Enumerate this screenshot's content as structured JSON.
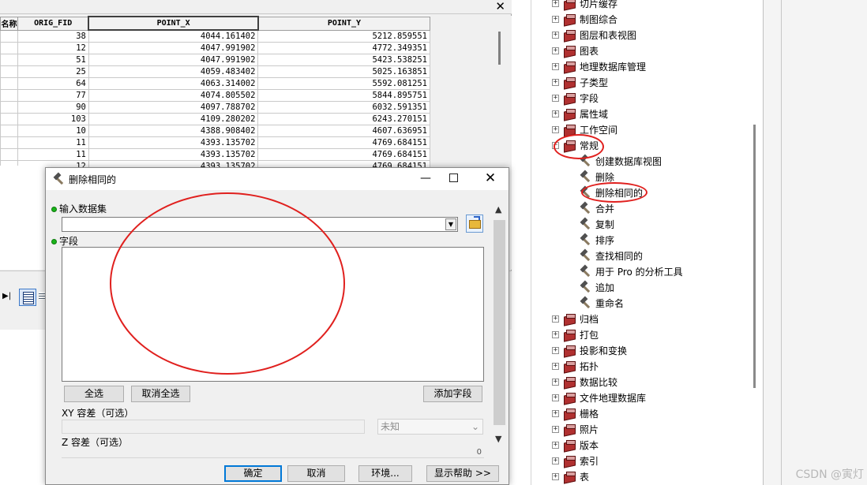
{
  "attribute_table": {
    "columns": [
      "名称",
      "ORIG_FID",
      "POINT_X",
      "POINT_Y"
    ],
    "rows": [
      {
        "orig_fid": "38",
        "point_x": "4044.161402",
        "point_y": "5212.859551"
      },
      {
        "orig_fid": "12",
        "point_x": "4047.991902",
        "point_y": "4772.349351"
      },
      {
        "orig_fid": "51",
        "point_x": "4047.991902",
        "point_y": "5423.538251"
      },
      {
        "orig_fid": "25",
        "point_x": "4059.483402",
        "point_y": "5025.163851"
      },
      {
        "orig_fid": "64",
        "point_x": "4063.314002",
        "point_y": "5592.081251"
      },
      {
        "orig_fid": "77",
        "point_x": "4074.805502",
        "point_y": "5844.895751"
      },
      {
        "orig_fid": "90",
        "point_x": "4097.788702",
        "point_y": "6032.591351"
      },
      {
        "orig_fid": "103",
        "point_x": "4109.280202",
        "point_y": "6243.270151"
      },
      {
        "orig_fid": "10",
        "point_x": "4388.908402",
        "point_y": "4607.636951"
      },
      {
        "orig_fid": "11",
        "point_x": "4393.135702",
        "point_y": "4769.684151"
      },
      {
        "orig_fid": "11",
        "point_x": "4393.135702",
        "point_y": "4769.684151"
      },
      {
        "orig_fid": "12",
        "point_x": "4393.135702",
        "point_y": "4769.684151"
      }
    ],
    "close_label": "✕"
  },
  "dialog": {
    "title": "删除相同的",
    "input_dataset_label": "输入数据集",
    "input_dataset_value": "",
    "fields_label": "字段",
    "select_all_label": "全选",
    "deselect_all_label": "取消全选",
    "add_field_label": "添加字段",
    "xy_tolerance_label": "XY 容差（可选）",
    "xy_tolerance_unit": "未知",
    "z_tolerance_label": "Z 容差（可选）",
    "z_tolerance_value": "0",
    "ok_label": "确定",
    "cancel_label": "取消",
    "environments_label": "环境...",
    "show_help_label": "显示帮助 >>",
    "minimize_glyph": "—",
    "close_glyph": "✕"
  },
  "toolbox_tree": {
    "toolsets": [
      {
        "label": "切片缓存",
        "expanded": false
      },
      {
        "label": "制图综合",
        "expanded": false
      },
      {
        "label": "图层和表视图",
        "expanded": false
      },
      {
        "label": "图表",
        "expanded": false
      },
      {
        "label": "地理数据库管理",
        "expanded": false
      },
      {
        "label": "子类型",
        "expanded": false
      },
      {
        "label": "字段",
        "expanded": false
      },
      {
        "label": "属性域",
        "expanded": false
      },
      {
        "label": "工作空间",
        "expanded": false
      },
      {
        "label": "常规",
        "expanded": true
      }
    ],
    "general_tools": [
      "创建数据库视图",
      "删除",
      "删除相同的",
      "合并",
      "复制",
      "排序",
      "查找相同的",
      "用于 Pro 的分析工具",
      "追加",
      "重命名"
    ],
    "toolsets_after": [
      "归档",
      "打包",
      "投影和变换",
      "拓扑",
      "数据比较",
      "文件地理数据库",
      "栅格",
      "照片",
      "版本",
      "索引",
      "表"
    ],
    "expand_glyph": "+",
    "collapse_glyph": "−"
  },
  "watermark": "CSDN @寅灯",
  "colors": {
    "annotation_red": "#e0201e",
    "required_dot": "#19b419",
    "dialog_bg": "#f0f0f0",
    "primary_button_border": "#0078d7"
  },
  "icons": {
    "toolset": "toolbox-icon",
    "tool": "hammer-icon",
    "browse": "open-folder-icon"
  }
}
